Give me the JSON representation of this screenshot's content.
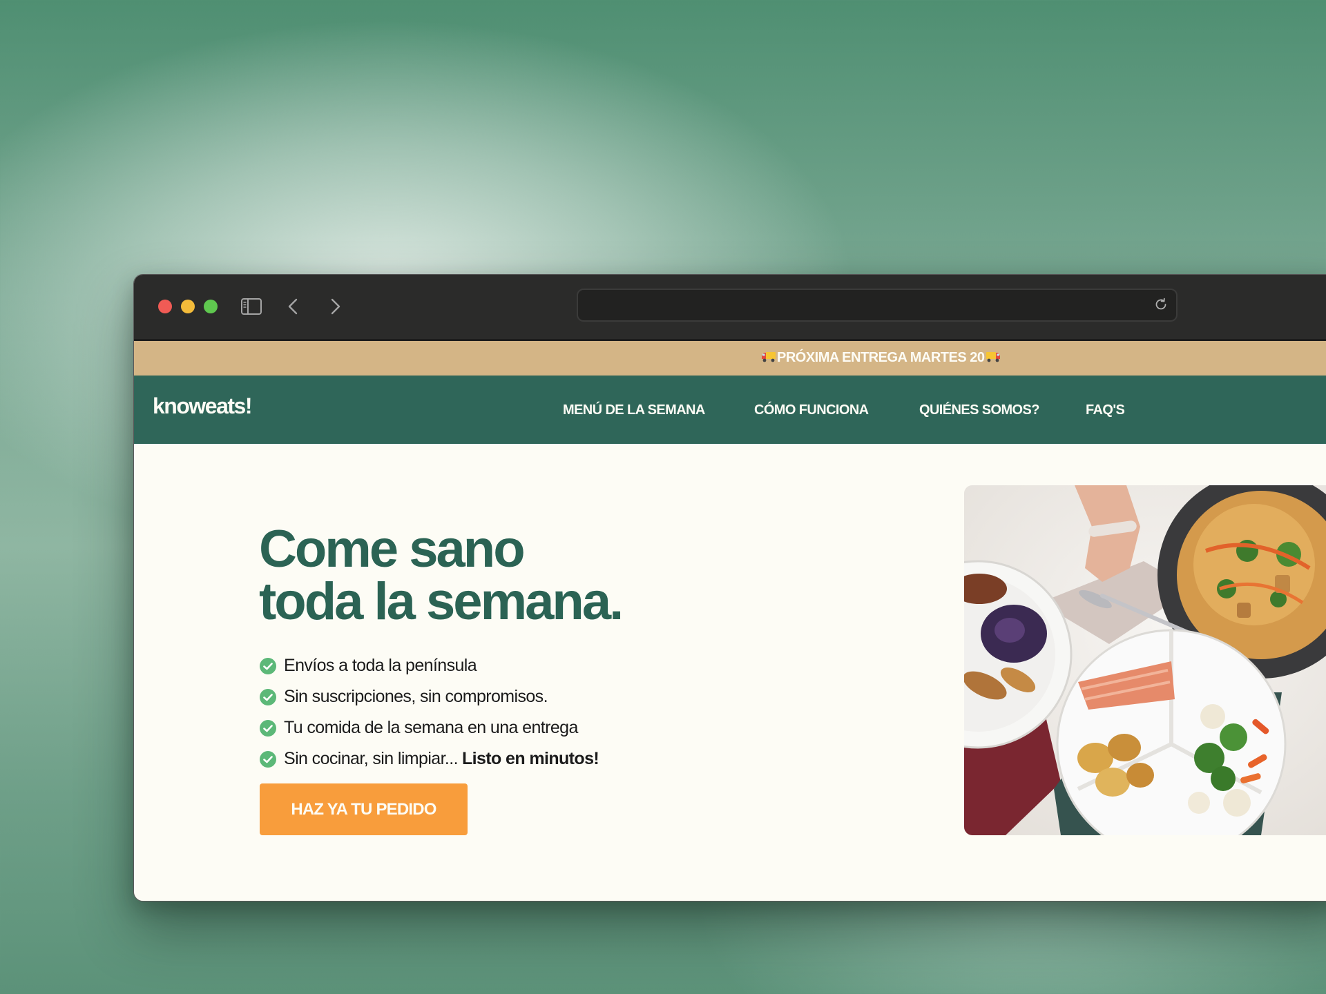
{
  "browser": {
    "url": ""
  },
  "announcement": {
    "text": "PRÓXIMA ENTREGA MARTES 20",
    "icon": "truck-emoji"
  },
  "nav": {
    "logo": "knoweats!",
    "links": [
      "MENÚ DE LA SEMANA",
      "CÓMO FUNCIONA",
      "QUIÉNES SOMOS?",
      "FAQ'S"
    ]
  },
  "hero": {
    "title_line1": "Come sano",
    "title_line2": "toda la semana.",
    "features": [
      {
        "text": "Envíos a toda la península"
      },
      {
        "text": "Sin suscripciones, sin compromisos."
      },
      {
        "text": "Tu comida de la semana en una entrega"
      },
      {
        "text": "Sin cocinar, sin limpiar...",
        "bold": "Listo en minutos!"
      }
    ],
    "cta": "HAZ YA TU PEDIDO"
  },
  "colors": {
    "brand_green": "#2f6659",
    "title_green": "#2b6354",
    "announce_tan": "#d4b586",
    "cta_orange": "#f89d3c",
    "check_green": "#5cb878",
    "page_bg": "#fdfcf5"
  }
}
